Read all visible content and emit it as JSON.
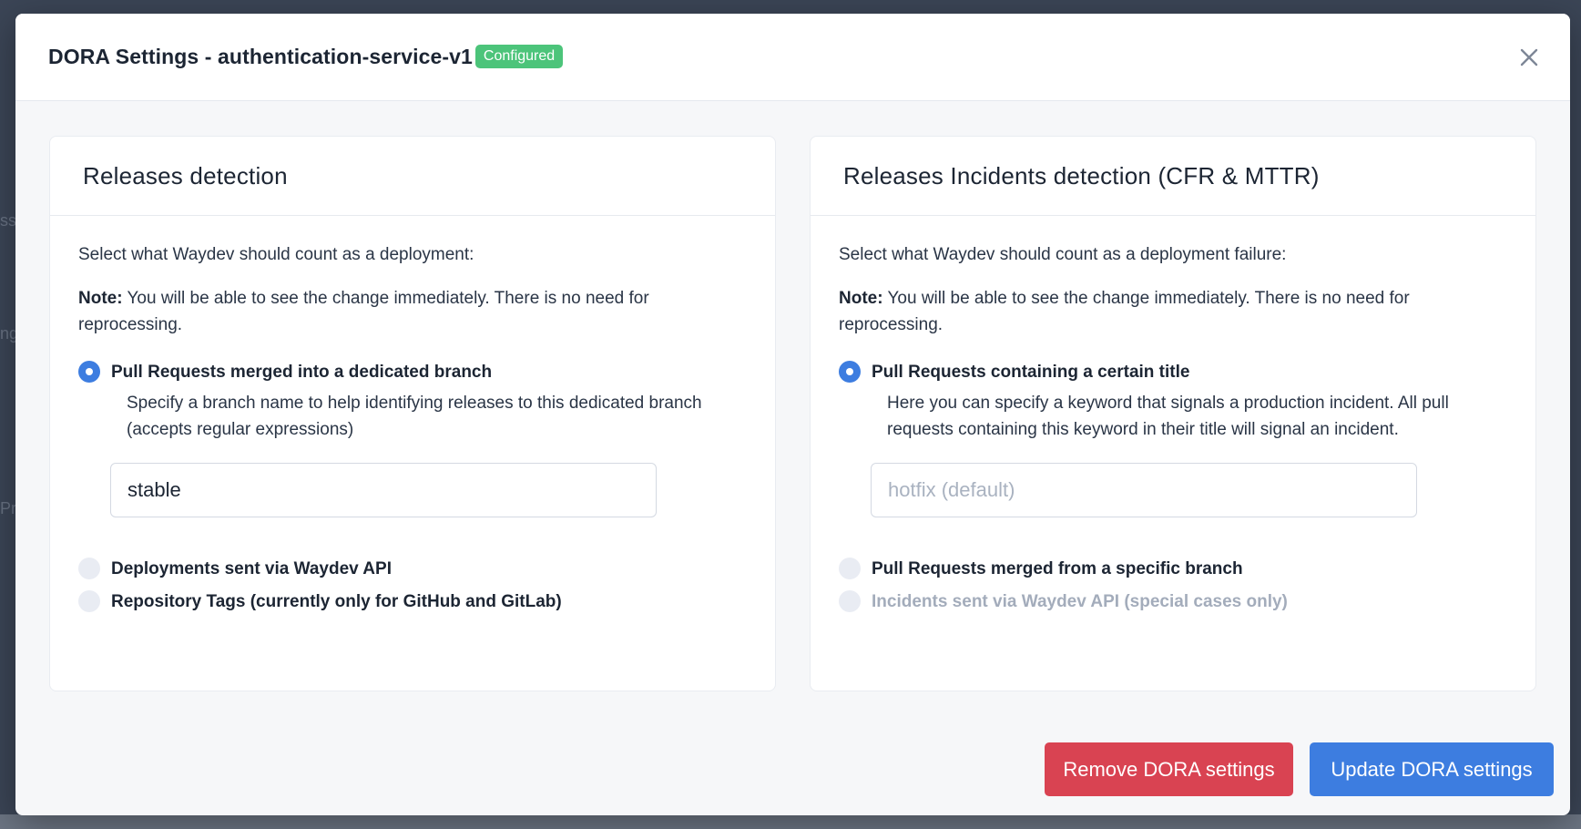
{
  "modal": {
    "title": "DORA Settings - authentication-service-v1",
    "status_badge": "Configured"
  },
  "releases_panel": {
    "title": "Releases detection",
    "intro": "Select what Waydev should count as a deployment:",
    "note_label": "Note:",
    "note_text": " You will be able to see the change immediately. There is no need for reprocessing.",
    "options": [
      {
        "label": "Pull Requests merged into a dedicated branch",
        "checked": true
      },
      {
        "label": "Deployments sent via Waydev API",
        "checked": false
      },
      {
        "label": "Repository Tags (currently only for GitHub and GitLab)",
        "checked": false
      }
    ],
    "selected_description": "Specify a branch name to help identifying releases to this dedicated branch (accepts regular expressions)",
    "branch_input": {
      "value": "stable",
      "placeholder": ""
    }
  },
  "incidents_panel": {
    "title": "Releases Incidents detection (CFR & MTTR)",
    "intro": "Select what Waydev should count as a deployment failure:",
    "note_label": "Note:",
    "note_text": " You will be able to see the change immediately. There is no need for reprocessing.",
    "options": [
      {
        "label": "Pull Requests containing a certain title",
        "checked": true
      },
      {
        "label": "Pull Requests merged from a specific branch",
        "checked": false
      },
      {
        "label": "Incidents sent via Waydev API (special cases only)",
        "checked": false,
        "disabled": true
      }
    ],
    "selected_description": "Here you can specify a keyword that signals a production incident. All pull requests containing this keyword in their title will signal an incident.",
    "keyword_input": {
      "value": "",
      "placeholder": "hotfix (default)"
    }
  },
  "footer": {
    "remove_label": "Remove DORA settings",
    "update_label": "Update DORA settings"
  },
  "colors": {
    "primary": "#3d7de0",
    "danger": "#d94352",
    "success": "#4cc47a"
  },
  "icons": {
    "close": "close-icon"
  }
}
